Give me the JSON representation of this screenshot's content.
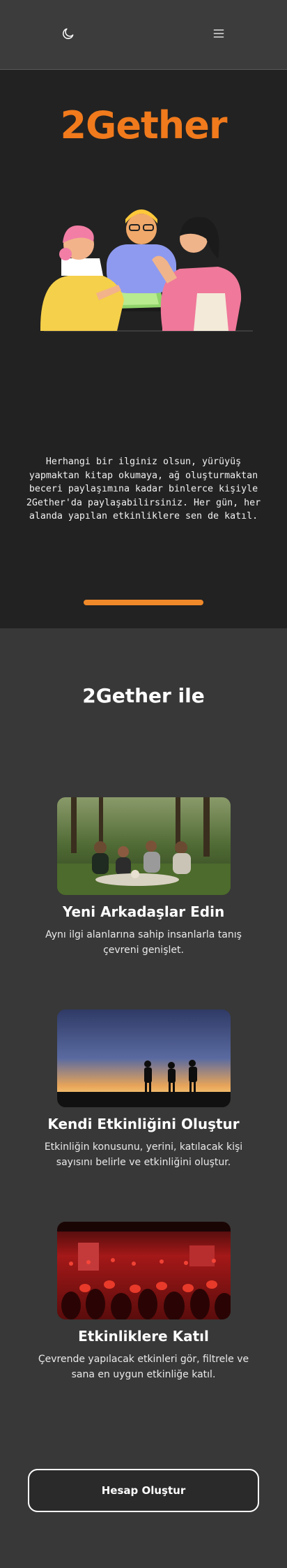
{
  "header": {
    "theme_toggle_icon": "moon-icon",
    "menu_icon": "hamburger-menu-icon"
  },
  "hero": {
    "logo": "2Gether",
    "illustration": "people-collaborating-illustration",
    "text": "Herhangi bir ilginiz olsun, yürüyüş yapmaktan kitap okumaya, ağ oluşturmaktan beceri paylaşımına kadar binlerce kişiyle 2Gether'da paylaşabilirsiniz. Her gün, her alanda yapılan etkinliklere sen de katıl.",
    "accent_color": "#f07a1c"
  },
  "features": {
    "title": "2Gether ile",
    "items": [
      {
        "image": "friends-picnic-photo",
        "title": "Yeni Arkadaşlar Edin",
        "description": "Aynı ilgi alanlarına sahip insanlarla tanış çevreni genişlet."
      },
      {
        "image": "hikers-sunset-photo",
        "title": "Kendi Etkinliğini Oluştur",
        "description": "Etkinliğin konusunu, yerini, katılacak kişi sayısını belirle ve etkinliğini oluştur."
      },
      {
        "image": "concert-crowd-photo",
        "title": "Etkinliklere Katıl",
        "description": "Çevrende yapılacak etkinleri gör, filtrele ve sana en uygun etkinliğe katıl."
      }
    ]
  },
  "cta": {
    "label": "Hesap Oluştur"
  }
}
